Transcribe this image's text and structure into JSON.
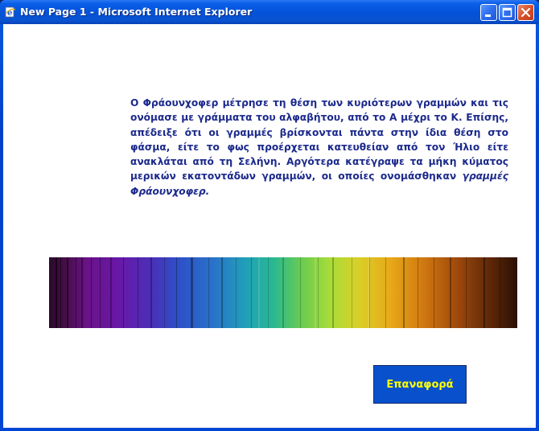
{
  "window": {
    "title": "New Page 1 - Microsoft Internet Explorer",
    "app_icon": "internet-explorer-icon",
    "controls": [
      "minimize-icon",
      "maximize-icon",
      "close-icon"
    ]
  },
  "content": {
    "paragraph_text": "Ο Φράουνχοφερ μέτρησε τη θέση των κυριότερων γραμμών και τις ονόμασε με γράμματα του αλφαβήτου, από το Α μέχρι το Κ. Επίσης, απέδειξε ότι οι γραμμές βρίσκονται πάντα στην ίδια θέση στο φάσμα, είτε το φως προέρχεται κατευθείαν από τον Ήλιο είτε ανακλάται από τη Σελήνη. Αργότερα κατέγραψε τα μήκη κύματος μερικών εκατοντάδων γραμμών, οι οποίες ονομάσθηκαν ",
    "paragraph_emphasis": "γραμμές Φράουνχοφερ.",
    "spectrum_image": "solar-spectrum-with-fraunhofer-lines",
    "reset_button_label": "Επαναφορά"
  },
  "colors": {
    "text": "#1c2a8c",
    "button_bg": "#0850cc",
    "button_text": "#ffff00"
  }
}
